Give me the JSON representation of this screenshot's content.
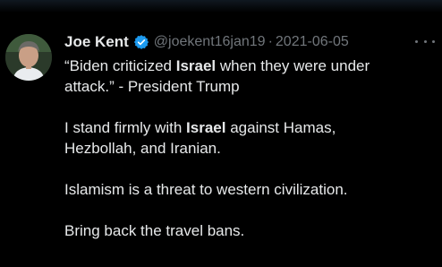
{
  "tweet": {
    "author_name": "Joe Kent",
    "handle": "@joekent16jan19",
    "separator": "·",
    "date": "2021-06-05",
    "verified_icon": "verified-badge-icon",
    "more_icon": "more-options-icon",
    "accent_color": "#1d9bf0",
    "paragraphs": [
      {
        "lines": [
          [
            {
              "text": "“Biden criticized ",
              "bold": false
            },
            {
              "text": "Israel",
              "bold": true
            },
            {
              "text": " when they were under",
              "bold": false
            }
          ],
          [
            {
              "text": "attack.” - President Trump",
              "bold": false
            }
          ]
        ]
      },
      {
        "lines": [
          [
            {
              "text": "I stand firmly with ",
              "bold": false
            },
            {
              "text": "Israel",
              "bold": true
            },
            {
              "text": " against Hamas,",
              "bold": false
            }
          ],
          [
            {
              "text": "Hezbollah, and Iranian.",
              "bold": false
            }
          ]
        ]
      },
      {
        "lines": [
          [
            {
              "text": "Islamism is a threat to western civilization.",
              "bold": false
            }
          ]
        ]
      },
      {
        "lines": [
          [
            {
              "text": "Bring back the travel bans.",
              "bold": false
            }
          ]
        ]
      }
    ]
  }
}
